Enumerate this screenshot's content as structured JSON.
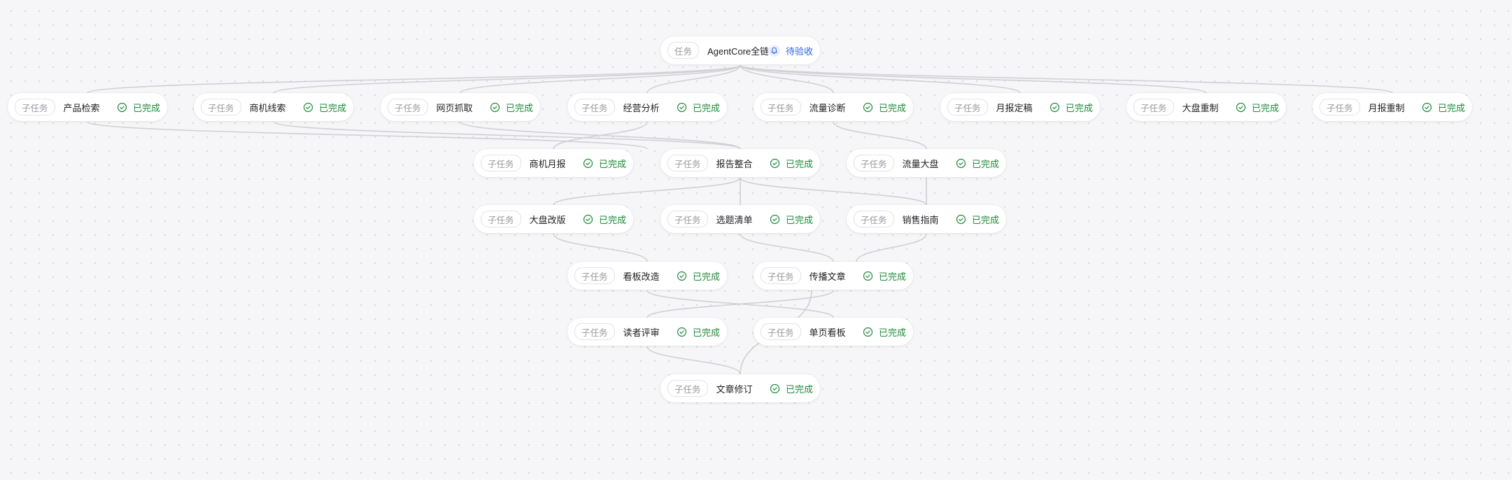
{
  "canvas": {
    "background": "#f6f6f8",
    "edge_color": "#cfcfd6",
    "done_color": "#1f8a3b",
    "pending_color": "#2c64ea"
  },
  "root": {
    "tag": "任务",
    "name": "AgentCore全链...",
    "status": "待验收",
    "status_icon": "bell-icon"
  },
  "subtask_tag": "子任务",
  "done_label": "已完成",
  "done_icon": "check-circle-icon",
  "nodes": [
    {
      "id": "n1",
      "name": "产品检索"
    },
    {
      "id": "n2",
      "name": "商机线索"
    },
    {
      "id": "n3",
      "name": "网页抓取"
    },
    {
      "id": "n4",
      "name": "经营分析"
    },
    {
      "id": "n5",
      "name": "流量诊断"
    },
    {
      "id": "n6",
      "name": "月报定稿"
    },
    {
      "id": "n7",
      "name": "大盘重制"
    },
    {
      "id": "n8",
      "name": "月报重制"
    },
    {
      "id": "m1",
      "name": "商机月报"
    },
    {
      "id": "m2",
      "name": "报告整合"
    },
    {
      "id": "m3",
      "name": "流量大盘"
    },
    {
      "id": "p1",
      "name": "大盘改版"
    },
    {
      "id": "p2",
      "name": "选题清单"
    },
    {
      "id": "p3",
      "name": "销售指南"
    },
    {
      "id": "q1",
      "name": "看板改造"
    },
    {
      "id": "q2",
      "name": "传播文章"
    },
    {
      "id": "r1",
      "name": "读者评审"
    },
    {
      "id": "r2",
      "name": "单页看板"
    },
    {
      "id": "s1",
      "name": "文章修订"
    }
  ]
}
